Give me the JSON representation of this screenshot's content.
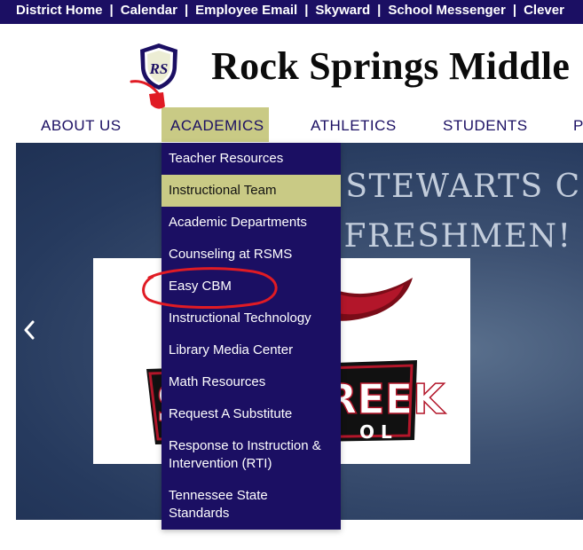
{
  "topbar": {
    "links": [
      "District Home",
      "Calendar",
      "Employee Email",
      "Skyward",
      "School Messenger",
      "Clever"
    ],
    "separator": "|"
  },
  "header": {
    "logo_text": "RS",
    "school_name": "Rock Springs Middle"
  },
  "nav": {
    "items": [
      "ABOUT US",
      "ACADEMICS",
      "ATHLETICS",
      "STUDENTS",
      "P"
    ],
    "active_index": 1
  },
  "hero": {
    "heading_line1": "UNG STEWARTS C",
    "heading_line2": "FRESHMEN!",
    "card_text_left": "S",
    "card_text_right": "REEK",
    "card_subtext": "O  L"
  },
  "dropdown": {
    "items": [
      "Teacher Resources",
      "Instructional Team",
      "Academic Departments",
      "Counseling at RSMS",
      "Easy CBM",
      "Instructional Technology",
      "Library Media Center",
      "Math Resources",
      "Request A Substitute",
      "Response to Instruction & Intervention (RTI)",
      "Tennessee State Standards"
    ],
    "item_lines": [
      [
        "Teacher Resources"
      ],
      [
        "Instructional Team"
      ],
      [
        "Academic Departments"
      ],
      [
        "Counseling at RSMS"
      ],
      [
        "Easy CBM"
      ],
      [
        "Instructional Technology"
      ],
      [
        "Library Media Center"
      ],
      [
        "Math Resources"
      ],
      [
        "Request A Substitute"
      ],
      [
        "Response to Instruction &",
        "Intervention (RTI)"
      ],
      [
        "Tennessee State",
        "Standards"
      ]
    ],
    "hovered_index": 1
  },
  "colors": {
    "brand_navy": "#1b0f63",
    "accent_khaki": "#c9ca85",
    "annotation_red": "#e01b24"
  }
}
